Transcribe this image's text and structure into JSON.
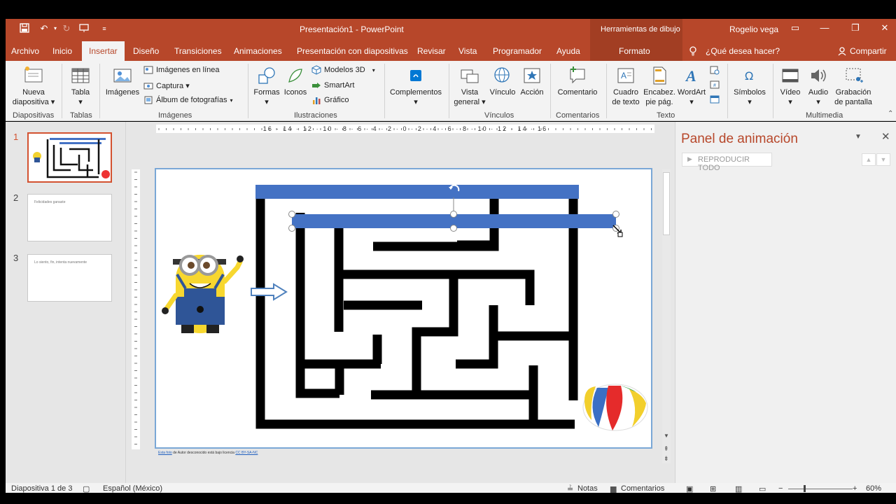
{
  "title_bar": {
    "doc_title": "Presentación1  -  PowerPoint",
    "context_tools": "Herramientas de dibujo",
    "user": "Rogelio vega"
  },
  "tabs": [
    {
      "label": "Archivo"
    },
    {
      "label": "Inicio"
    },
    {
      "label": "Insertar",
      "active": true
    },
    {
      "label": "Diseño"
    },
    {
      "label": "Transiciones"
    },
    {
      "label": "Animaciones"
    },
    {
      "label": "Presentación con diapositivas"
    },
    {
      "label": "Revisar"
    },
    {
      "label": "Vista"
    },
    {
      "label": "Programador"
    },
    {
      "label": "Ayuda"
    },
    {
      "label": "Formato"
    }
  ],
  "tell_me": "¿Qué desea hacer?",
  "share": "Compartir",
  "ribbon": {
    "nueva_diapositiva": [
      "Nueva",
      "diapositiva ▾"
    ],
    "tabla": "Tabla",
    "imagenes": "Imágenes",
    "imagenes_en_linea": "Imágenes en línea",
    "captura": "Captura ▾",
    "album": "Álbum de fotografías",
    "formas": "Formas",
    "iconos": "Iconos",
    "modelos_3d": "Modelos 3D",
    "smartart": "SmartArt",
    "grafico": "Gráfico",
    "complementos": "Complementos",
    "vista_general": [
      "Vista",
      "general ▾"
    ],
    "vinculo": "Vínculo",
    "accion": "Acción",
    "comentario": "Comentario",
    "cuadro_texto": [
      "Cuadro",
      "de texto"
    ],
    "encabez": [
      "Encabez.",
      "pie pág."
    ],
    "wordart": "WordArt",
    "simbolos": "Símbolos",
    "video": "Vídeo",
    "audio": "Audio",
    "grabacion": [
      "Grabación",
      "de pantalla"
    ],
    "groups": {
      "diapositivas": "Diapositivas",
      "tablas": "Tablas",
      "imagenes": "Imágenes",
      "ilustraciones": "Ilustraciones",
      "vinculos": "Vínculos",
      "comentarios": "Comentarios",
      "texto": "Texto",
      "multimedia": "Multimedia"
    }
  },
  "ruler_h_labels": "16 · 14 · 12 · 10 · 8 · 6 · 4 · 2 · 0 · 2 · 4 · 6 · 8 · 10 · 12 · 14 · 16",
  "thumbnails": [
    {
      "num": "1",
      "text": ""
    },
    {
      "num": "2",
      "text": "Felicidades ganaste"
    },
    {
      "num": "3",
      "text": "Lo siento, fin, intenta nuevamente"
    }
  ],
  "credit": {
    "link1": "Esta foto",
    "middle": " de Autor desconocido está bajo licencia ",
    "link2": "CC BY-SA-NC"
  },
  "animation_pane": {
    "title": "Panel de animación",
    "play_all": "REPRODUCIR TODO"
  },
  "statusbar": {
    "slide_info": "Diapositiva 1 de 3",
    "language": "Español (México)",
    "notes": "Notas",
    "comments": "Comentarios",
    "zoom": "60%"
  },
  "colors": {
    "accent": "#b7472a",
    "selection_bar": "#4472c4"
  }
}
